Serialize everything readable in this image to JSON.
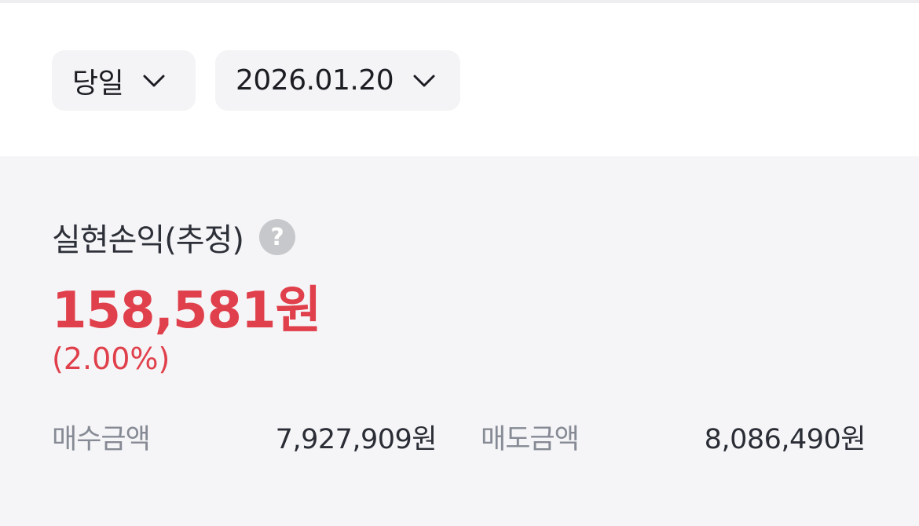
{
  "filters": {
    "period": {
      "label": "당일",
      "icon": "chevron-down-icon"
    },
    "date": {
      "label": "2026.01.20",
      "icon": "chevron-down-icon"
    }
  },
  "summary": {
    "title": "실현손익(추정)",
    "help_icon": "question-circle-icon",
    "help_glyph": "?",
    "amount": "158,581원",
    "rate": "(2.00%)",
    "buy": {
      "label": "매수금액",
      "value": "7,927,909원"
    },
    "sell": {
      "label": "매도금액",
      "value": "8,086,490원"
    }
  },
  "colors": {
    "profit": "#e0404b",
    "panel": "#f5f5f7",
    "pill": "#f4f4f6",
    "label_gray": "#868a94"
  }
}
